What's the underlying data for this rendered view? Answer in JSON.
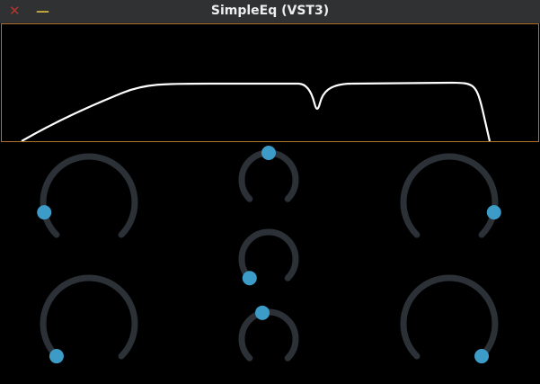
{
  "window": {
    "title": "SimpleEq (VST3)",
    "close_glyph": "✕",
    "minimize_glyph": "—",
    "close_icon": "close-icon",
    "minimize_icon": "minimize-icon"
  },
  "colors": {
    "background": "#000000",
    "titlebar": "#2f3133",
    "graph_border": "#b0702a",
    "curve": "#ffffff",
    "knob_track": "#2b3136",
    "knob_thumb": "#3d9bc8",
    "close": "#b8342c",
    "minimize": "#c6a93a"
  },
  "response_curve": {
    "description": "EQ frequency response",
    "low_cut": true,
    "peak_notch": true,
    "high_cut": true
  },
  "knobs": [
    {
      "id": "low-cut-freq",
      "value": 0.12
    },
    {
      "id": "low-cut-slope",
      "value": 0.0
    },
    {
      "id": "peak-freq",
      "value": 0.5
    },
    {
      "id": "peak-gain",
      "value": 0.0
    },
    {
      "id": "peak-quality",
      "value": 0.45
    },
    {
      "id": "high-cut-freq",
      "value": 0.88
    },
    {
      "id": "high-cut-slope",
      "value": 1.0
    }
  ]
}
